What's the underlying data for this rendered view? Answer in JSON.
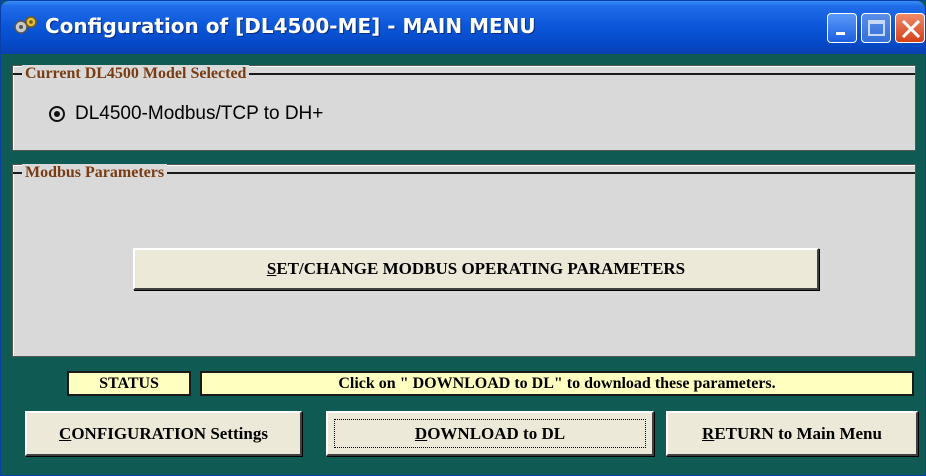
{
  "window": {
    "title": "Configuration of [DL4500-ME] - MAIN MENU"
  },
  "current_model": {
    "legend": "Current DL4500 Model Selected",
    "selected_option": "DL4500-Modbus/TCP to DH+"
  },
  "modbus": {
    "legend": "Modbus Parameters",
    "set_button": {
      "underlined": "S",
      "rest": "ET/CHANGE MODBUS OPERATING PARAMETERS"
    }
  },
  "status": {
    "label": "STATUS",
    "message": "Click on \" DOWNLOAD to DL\"  to download these parameters."
  },
  "buttons": {
    "config": {
      "underlined": "C",
      "rest": "ONFIGURATION Settings"
    },
    "download": {
      "underlined": "D",
      "rest": "OWNLOAD to DL"
    },
    "return": {
      "underlined": "R",
      "rest": "ETURN to Main Menu"
    }
  },
  "colors": {
    "window_bg": "#0f5a52",
    "titlebar": "#0a55d8",
    "legend_text": "#7a3c12",
    "status_bg": "#ffffc0"
  },
  "icons": {
    "app": "gear-icon",
    "minimize": "minimize-icon",
    "maximize": "maximize-icon",
    "close": "close-icon"
  }
}
